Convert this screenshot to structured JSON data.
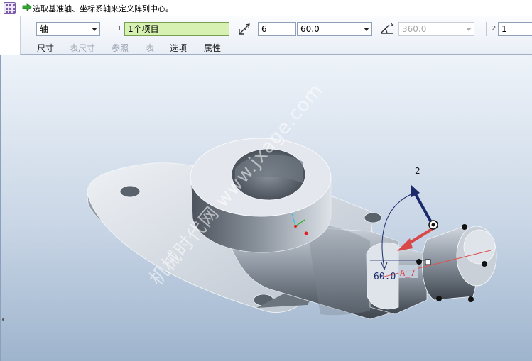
{
  "message": {
    "text": "选取基准轴、坐标系轴来定义阵列中心。"
  },
  "dashboard": {
    "pattern_type": "轴",
    "ref_count_label": "1",
    "ref_collector": "1个项目",
    "member_count": "6",
    "angle_increment": "60.0",
    "angle_extent": "360.0",
    "second_dir_label": "2",
    "second_dir_count": "1"
  },
  "tabs": [
    {
      "label": "尺寸",
      "enabled": true
    },
    {
      "label": "表尺寸",
      "enabled": false
    },
    {
      "label": "参照",
      "enabled": false
    },
    {
      "label": "表",
      "enabled": false
    },
    {
      "label": "选项",
      "enabled": true
    },
    {
      "label": "属性",
      "enabled": true
    }
  ],
  "viewport": {
    "direction_label": "2",
    "angle_dimension": "60.0",
    "axis_label": "A_7",
    "watermark": "机械时代网  www.jxage.com"
  },
  "colors": {
    "accent_green": "#d6f1b2",
    "handle_blue": "#1a2a6a",
    "arrow_red": "#d84848",
    "background_blue": "#c9d6e6"
  }
}
